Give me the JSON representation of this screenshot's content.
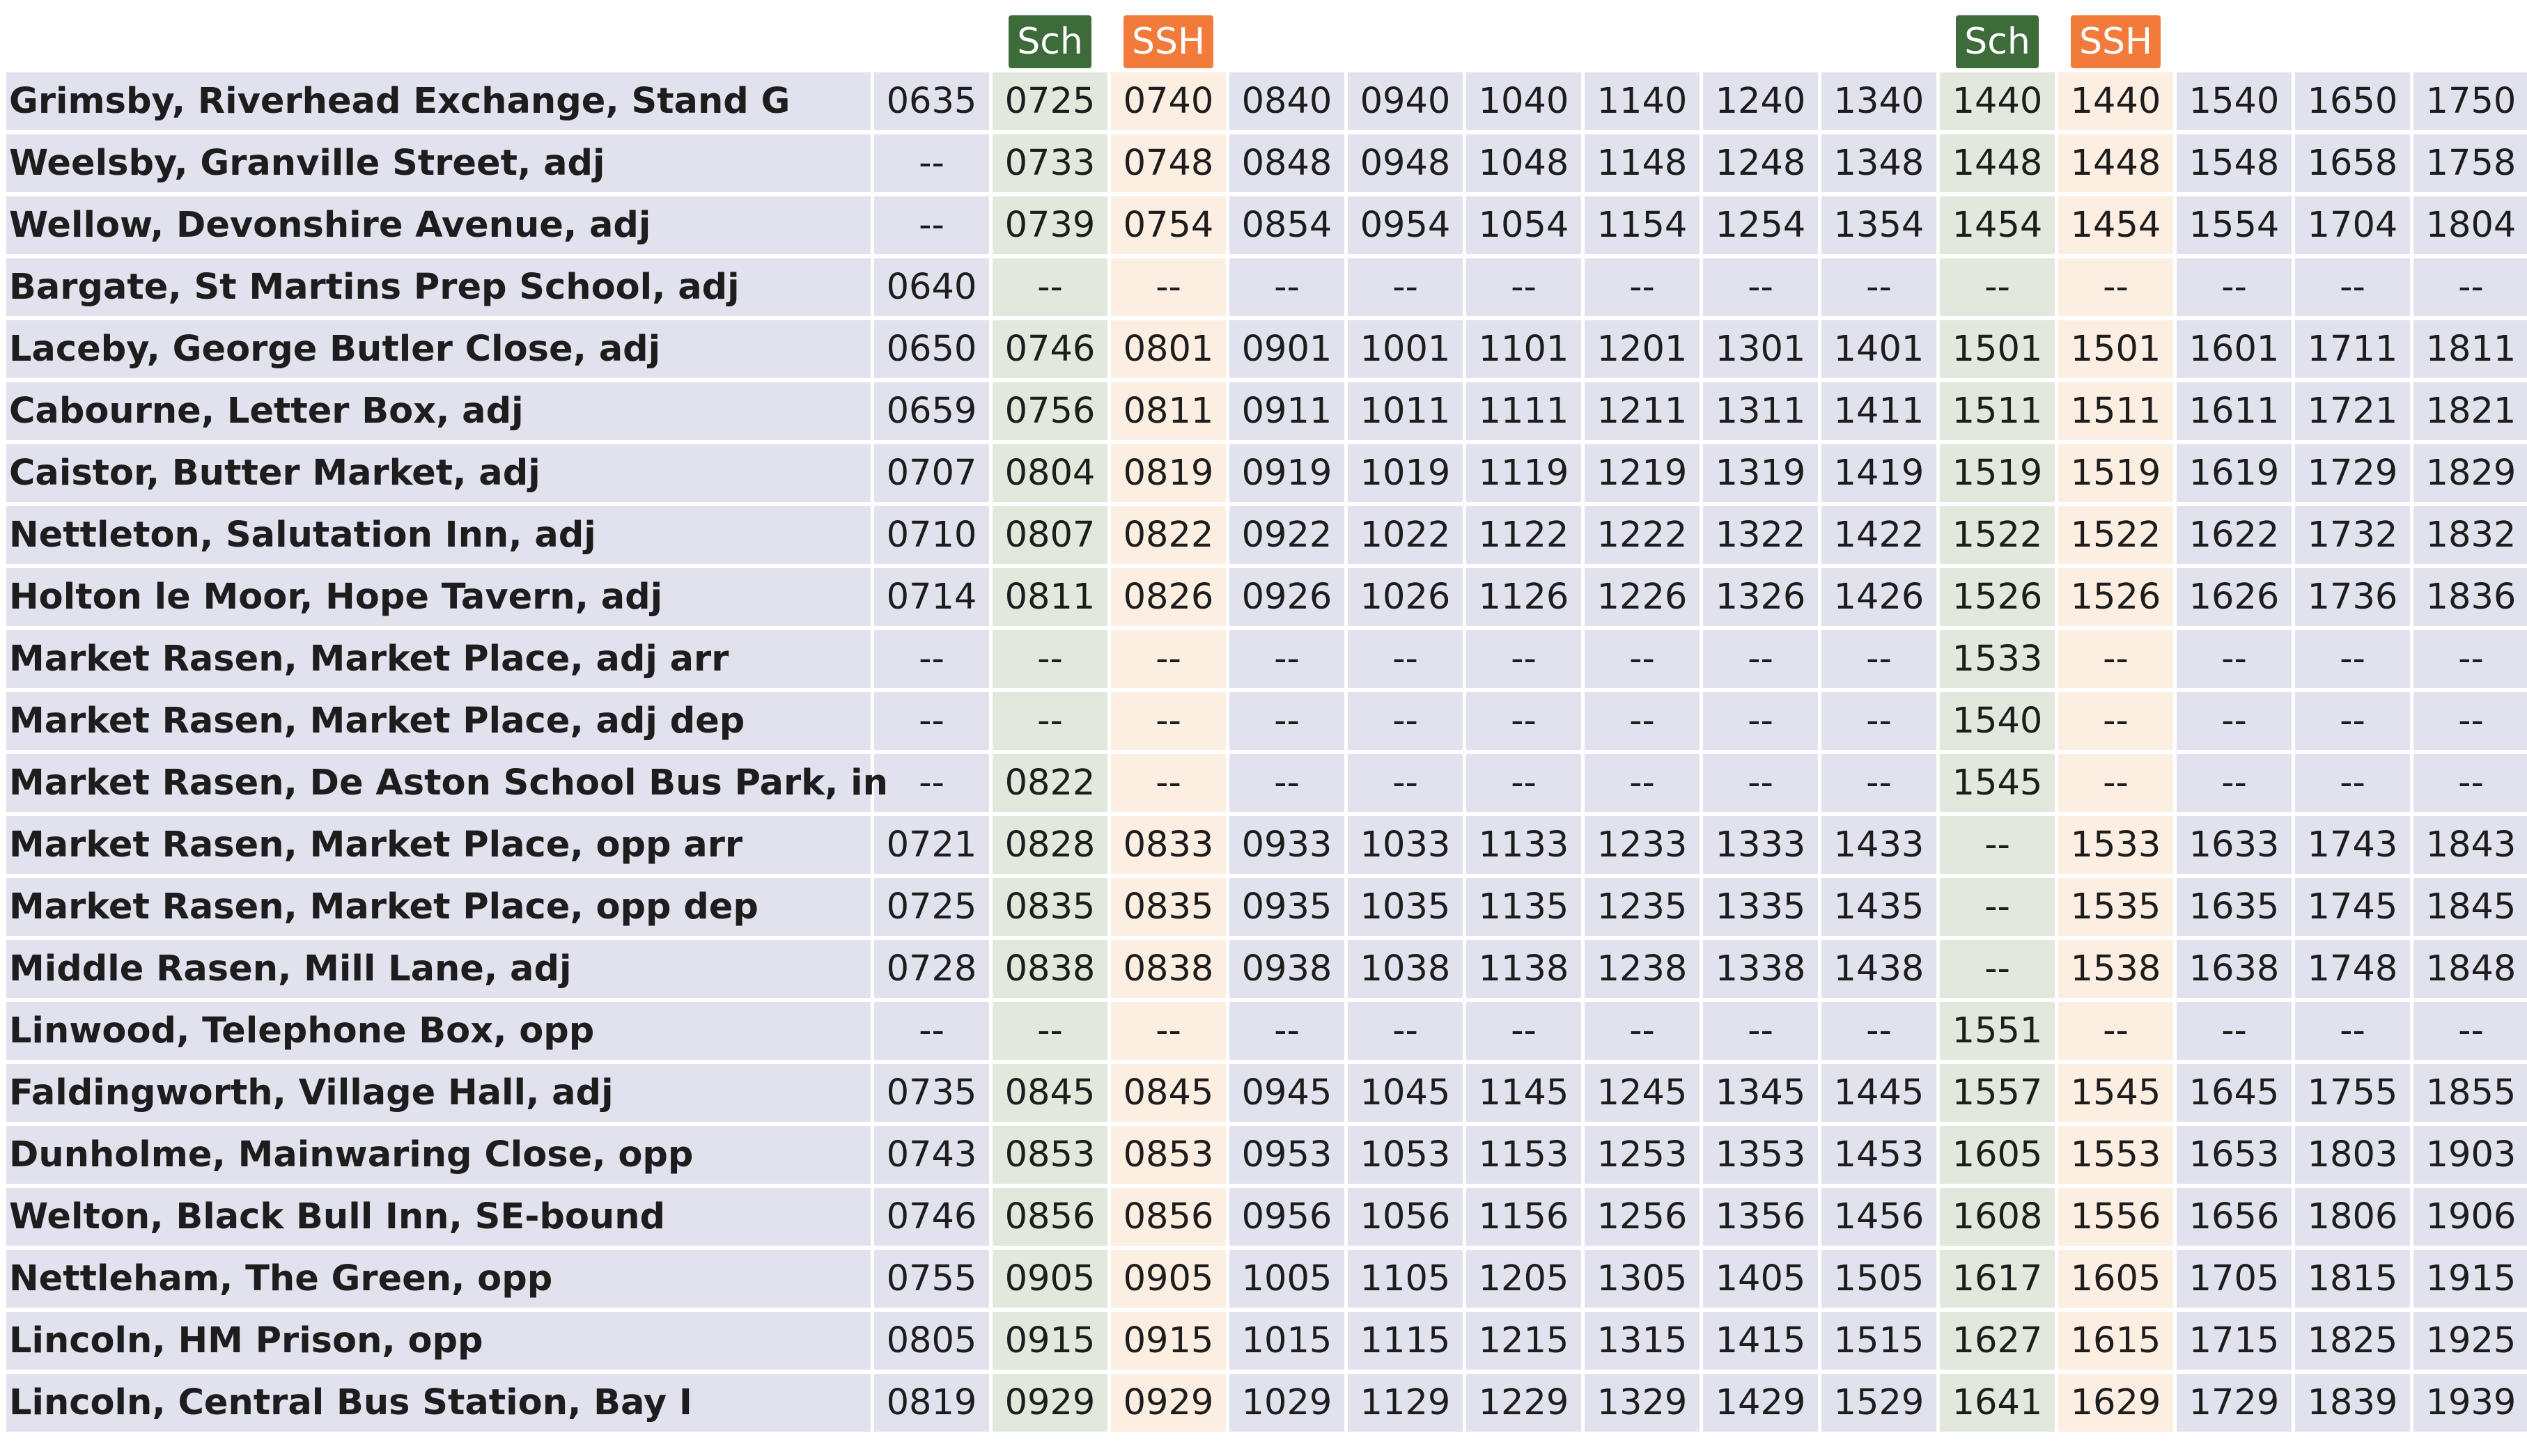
{
  "header_badges": [
    "",
    "Sch",
    "SSH",
    "",
    "",
    "",
    "",
    "",
    "",
    "Sch",
    "SSH",
    "",
    "",
    ""
  ],
  "columns": [
    "",
    "sch",
    "ssh",
    "",
    "",
    "",
    "",
    "",
    "",
    "sch",
    "ssh",
    "",
    "",
    ""
  ],
  "colors": {
    "row_bg": "#e1e2ed",
    "sch_bg": "#e3e8dc",
    "ssh_bg": "#fdeee2",
    "sch_badge": "#3d6b3a",
    "ssh_badge": "#f27b3b"
  },
  "rows": [
    {
      "stop": "Grimsby, Riverhead Exchange, Stand G",
      "times": [
        "0635",
        "0725",
        "0740",
        "0840",
        "0940",
        "1040",
        "1140",
        "1240",
        "1340",
        "1440",
        "1440",
        "1540",
        "1650",
        "1750"
      ]
    },
    {
      "stop": "Weelsby, Granville Street, adj",
      "times": [
        "--",
        "0733",
        "0748",
        "0848",
        "0948",
        "1048",
        "1148",
        "1248",
        "1348",
        "1448",
        "1448",
        "1548",
        "1658",
        "1758"
      ]
    },
    {
      "stop": "Wellow, Devonshire Avenue, adj",
      "times": [
        "--",
        "0739",
        "0754",
        "0854",
        "0954",
        "1054",
        "1154",
        "1254",
        "1354",
        "1454",
        "1454",
        "1554",
        "1704",
        "1804"
      ]
    },
    {
      "stop": "Bargate, St Martins Prep School, adj",
      "times": [
        "0640",
        "--",
        "--",
        "--",
        "--",
        "--",
        "--",
        "--",
        "--",
        "--",
        "--",
        "--",
        "--",
        "--"
      ]
    },
    {
      "stop": "Laceby, George Butler Close, adj",
      "times": [
        "0650",
        "0746",
        "0801",
        "0901",
        "1001",
        "1101",
        "1201",
        "1301",
        "1401",
        "1501",
        "1501",
        "1601",
        "1711",
        "1811"
      ]
    },
    {
      "stop": "Cabourne, Letter Box, adj",
      "times": [
        "0659",
        "0756",
        "0811",
        "0911",
        "1011",
        "1111",
        "1211",
        "1311",
        "1411",
        "1511",
        "1511",
        "1611",
        "1721",
        "1821"
      ]
    },
    {
      "stop": "Caistor, Butter Market, adj",
      "times": [
        "0707",
        "0804",
        "0819",
        "0919",
        "1019",
        "1119",
        "1219",
        "1319",
        "1419",
        "1519",
        "1519",
        "1619",
        "1729",
        "1829"
      ]
    },
    {
      "stop": "Nettleton, Salutation Inn, adj",
      "times": [
        "0710",
        "0807",
        "0822",
        "0922",
        "1022",
        "1122",
        "1222",
        "1322",
        "1422",
        "1522",
        "1522",
        "1622",
        "1732",
        "1832"
      ]
    },
    {
      "stop": "Holton le Moor, Hope Tavern, adj",
      "times": [
        "0714",
        "0811",
        "0826",
        "0926",
        "1026",
        "1126",
        "1226",
        "1326",
        "1426",
        "1526",
        "1526",
        "1626",
        "1736",
        "1836"
      ]
    },
    {
      "stop": "Market Rasen, Market Place, adj arr",
      "times": [
        "--",
        "--",
        "--",
        "--",
        "--",
        "--",
        "--",
        "--",
        "--",
        "1533",
        "--",
        "--",
        "--",
        "--"
      ]
    },
    {
      "stop": "Market Rasen, Market Place, adj dep",
      "times": [
        "--",
        "--",
        "--",
        "--",
        "--",
        "--",
        "--",
        "--",
        "--",
        "1540",
        "--",
        "--",
        "--",
        "--"
      ]
    },
    {
      "stop": "Market Rasen, De Aston School Bus Park, in",
      "times": [
        "--",
        "0822",
        "--",
        "--",
        "--",
        "--",
        "--",
        "--",
        "--",
        "1545",
        "--",
        "--",
        "--",
        "--"
      ]
    },
    {
      "stop": "Market Rasen, Market Place, opp arr",
      "times": [
        "0721",
        "0828",
        "0833",
        "0933",
        "1033",
        "1133",
        "1233",
        "1333",
        "1433",
        "--",
        "1533",
        "1633",
        "1743",
        "1843"
      ]
    },
    {
      "stop": "Market Rasen, Market Place, opp dep",
      "times": [
        "0725",
        "0835",
        "0835",
        "0935",
        "1035",
        "1135",
        "1235",
        "1335",
        "1435",
        "--",
        "1535",
        "1635",
        "1745",
        "1845"
      ]
    },
    {
      "stop": "Middle Rasen, Mill Lane, adj",
      "times": [
        "0728",
        "0838",
        "0838",
        "0938",
        "1038",
        "1138",
        "1238",
        "1338",
        "1438",
        "--",
        "1538",
        "1638",
        "1748",
        "1848"
      ]
    },
    {
      "stop": "Linwood, Telephone Box, opp",
      "times": [
        "--",
        "--",
        "--",
        "--",
        "--",
        "--",
        "--",
        "--",
        "--",
        "1551",
        "--",
        "--",
        "--",
        "--"
      ]
    },
    {
      "stop": "Faldingworth, Village Hall, adj",
      "times": [
        "0735",
        "0845",
        "0845",
        "0945",
        "1045",
        "1145",
        "1245",
        "1345",
        "1445",
        "1557",
        "1545",
        "1645",
        "1755",
        "1855"
      ]
    },
    {
      "stop": "Dunholme, Mainwaring Close, opp",
      "times": [
        "0743",
        "0853",
        "0853",
        "0953",
        "1053",
        "1153",
        "1253",
        "1353",
        "1453",
        "1605",
        "1553",
        "1653",
        "1803",
        "1903"
      ]
    },
    {
      "stop": "Welton, Black Bull Inn, SE-bound",
      "times": [
        "0746",
        "0856",
        "0856",
        "0956",
        "1056",
        "1156",
        "1256",
        "1356",
        "1456",
        "1608",
        "1556",
        "1656",
        "1806",
        "1906"
      ]
    },
    {
      "stop": "Nettleham, The Green, opp",
      "times": [
        "0755",
        "0905",
        "0905",
        "1005",
        "1105",
        "1205",
        "1305",
        "1405",
        "1505",
        "1617",
        "1605",
        "1705",
        "1815",
        "1915"
      ]
    },
    {
      "stop": "Lincoln, HM Prison, opp",
      "times": [
        "0805",
        "0915",
        "0915",
        "1015",
        "1115",
        "1215",
        "1315",
        "1415",
        "1515",
        "1627",
        "1615",
        "1715",
        "1825",
        "1925"
      ]
    },
    {
      "stop": "Lincoln, Central Bus Station, Bay I",
      "times": [
        "0819",
        "0929",
        "0929",
        "1029",
        "1129",
        "1229",
        "1329",
        "1429",
        "1529",
        "1641",
        "1629",
        "1729",
        "1839",
        "1939"
      ]
    }
  ]
}
